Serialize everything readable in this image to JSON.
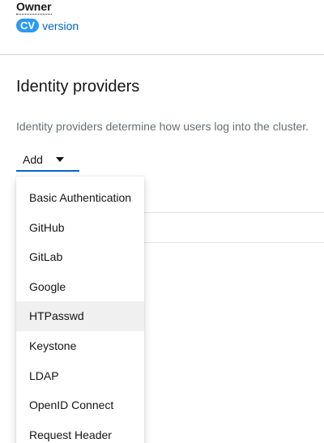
{
  "owner": {
    "label": "Owner",
    "badge": "CV",
    "link_text": "version"
  },
  "identity_providers": {
    "title": "Identity providers",
    "description": "Identity providers determine how users log into the cluster.",
    "add_label": "Add",
    "menu_items": [
      "Basic Authentication",
      "GitHub",
      "GitLab",
      "Google",
      "HTPasswd",
      "Keystone",
      "LDAP",
      "OpenID Connect",
      "Request Header"
    ],
    "highlighted_item": "HTPasswd"
  },
  "colors": {
    "badge_bg": "#2b9af3",
    "link": "#0066cc",
    "hover_bg": "#f0f0f0"
  },
  "icons": {
    "add_toggle": "caret-down-icon"
  }
}
